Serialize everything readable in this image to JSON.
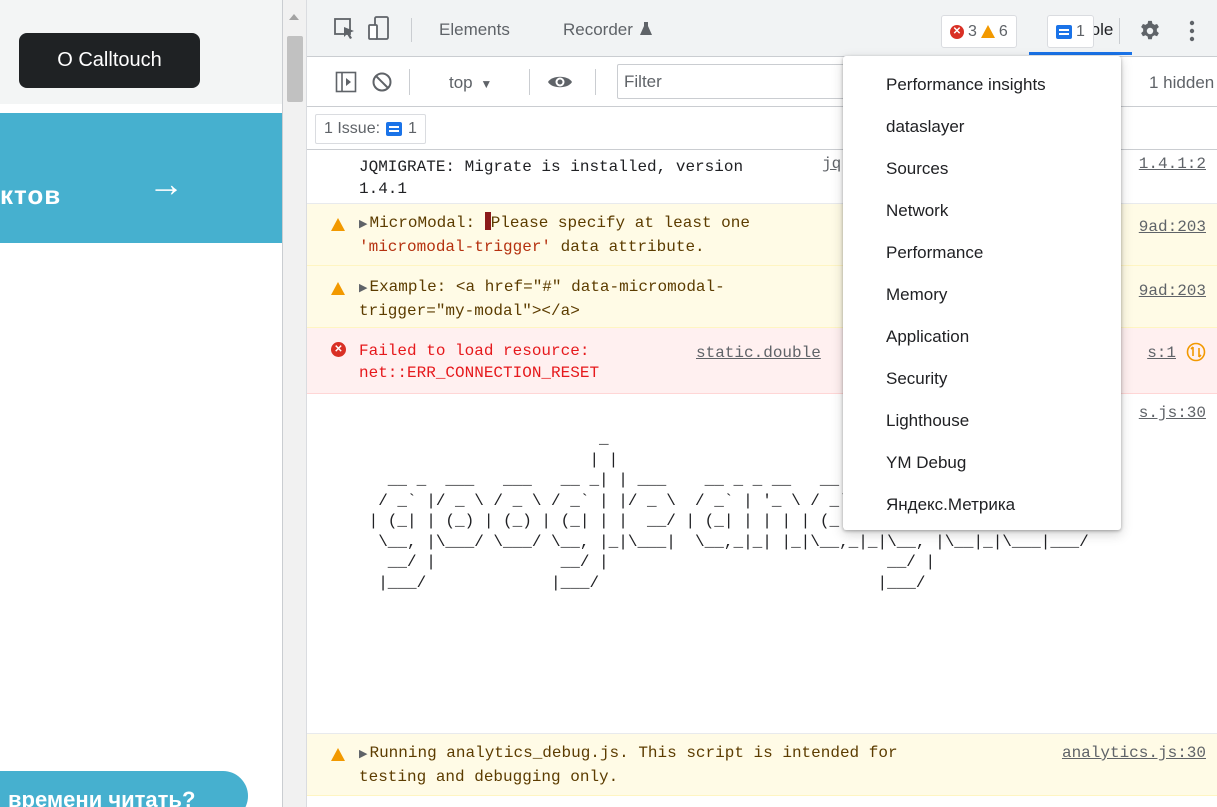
{
  "site": {
    "about_label": "О Calltouch",
    "cta_text": "ктов",
    "cta_arrow": "→",
    "read_text": "времени читать?"
  },
  "devtools": {
    "tabs": [
      "Elements",
      "Recorder",
      "Console"
    ],
    "more_tabs_glyph": "»",
    "error_count": "3",
    "warning_count": "6",
    "issue_count": "1",
    "toolbar": {
      "context": "top",
      "filter_placeholder": "Filter",
      "hidden_text": "1 hidden"
    },
    "issues_label": "1 Issue:",
    "issues_count": "1",
    "messages": [
      {
        "text": "JQMIGRATE: Migrate is installed, version 1.4.1",
        "src": "jq",
        "src_right": "1.4.1:2"
      },
      {
        "prefix": "MicroModal:",
        "text": "Please specify at least one",
        "line2": "'micromodal-trigger'",
        "line2_rest": " data attribute.",
        "src": "9ad:203"
      },
      {
        "prefix": "Example:",
        "text": "<a href=\"#\" data-micromodal-",
        "line2": "trigger=\"my-modal\"></a>",
        "src": "9ad:203"
      },
      {
        "text": "Failed to load resource:",
        "line2": "net::ERR_CONNECTION_RESET",
        "src_mid": "static.double",
        "src": "s:1"
      },
      {
        "src": "s.js:30"
      },
      {
        "text": "Running analytics_debug.js. This script is intended for",
        "line2": "testing and debugging only.",
        "src": "analytics.js:30"
      }
    ],
    "ascii_art": "                         _\n                        | |\n   __ _  ___   ___   __ _| | ___    __ _ _ __   __ _| |_   _| |_(_) ___ ___\n  / _` |/ _ \\ / _ \\ / _` | |/ _ \\  / _` | '_ \\ / _` | | | | | __| |/ __/ __|\n | (_| | (_) | (_) | (_| | |  __/ | (_| | | | | (_| | | |_| | |_| | (__\\__ \\\n  \\__, |\\___/ \\___/ \\__, |_|\\___|  \\__,_|_| |_|\\__,_|_|\\__, |\\__|_|\\___|___/\n   __/ |             __/ |                             __/ |\n  |___/             |___/                             |___/",
    "more_menu": [
      "Performance insights",
      "dataslayer",
      "Sources",
      "Network",
      "Performance",
      "Memory",
      "Application",
      "Security",
      "Lighthouse",
      "YM Debug",
      "Яндекс.Метрика"
    ]
  }
}
